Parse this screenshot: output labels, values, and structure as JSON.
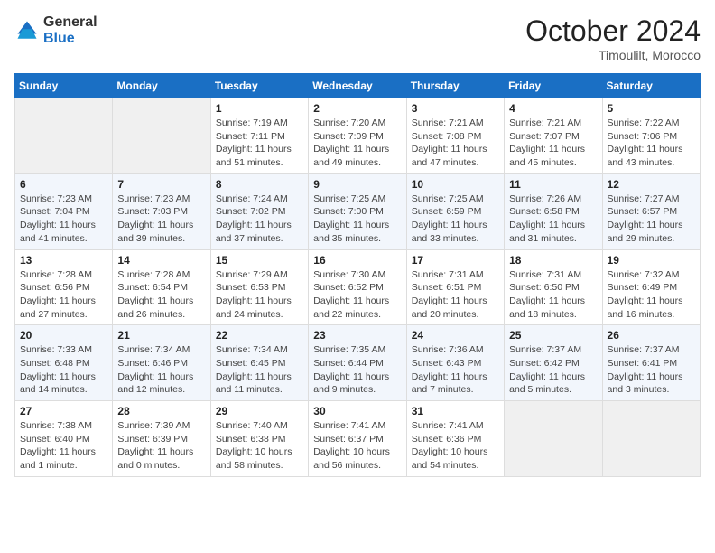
{
  "header": {
    "logo_general": "General",
    "logo_blue": "Blue",
    "month_title": "October 2024",
    "location": "Timoulilt, Morocco"
  },
  "days_of_week": [
    "Sunday",
    "Monday",
    "Tuesday",
    "Wednesday",
    "Thursday",
    "Friday",
    "Saturday"
  ],
  "weeks": [
    [
      {
        "day": "",
        "sunrise": "",
        "sunset": "",
        "daylight": ""
      },
      {
        "day": "",
        "sunrise": "",
        "sunset": "",
        "daylight": ""
      },
      {
        "day": "1",
        "sunrise": "Sunrise: 7:19 AM",
        "sunset": "Sunset: 7:11 PM",
        "daylight": "Daylight: 11 hours and 51 minutes."
      },
      {
        "day": "2",
        "sunrise": "Sunrise: 7:20 AM",
        "sunset": "Sunset: 7:09 PM",
        "daylight": "Daylight: 11 hours and 49 minutes."
      },
      {
        "day": "3",
        "sunrise": "Sunrise: 7:21 AM",
        "sunset": "Sunset: 7:08 PM",
        "daylight": "Daylight: 11 hours and 47 minutes."
      },
      {
        "day": "4",
        "sunrise": "Sunrise: 7:21 AM",
        "sunset": "Sunset: 7:07 PM",
        "daylight": "Daylight: 11 hours and 45 minutes."
      },
      {
        "day": "5",
        "sunrise": "Sunrise: 7:22 AM",
        "sunset": "Sunset: 7:06 PM",
        "daylight": "Daylight: 11 hours and 43 minutes."
      }
    ],
    [
      {
        "day": "6",
        "sunrise": "Sunrise: 7:23 AM",
        "sunset": "Sunset: 7:04 PM",
        "daylight": "Daylight: 11 hours and 41 minutes."
      },
      {
        "day": "7",
        "sunrise": "Sunrise: 7:23 AM",
        "sunset": "Sunset: 7:03 PM",
        "daylight": "Daylight: 11 hours and 39 minutes."
      },
      {
        "day": "8",
        "sunrise": "Sunrise: 7:24 AM",
        "sunset": "Sunset: 7:02 PM",
        "daylight": "Daylight: 11 hours and 37 minutes."
      },
      {
        "day": "9",
        "sunrise": "Sunrise: 7:25 AM",
        "sunset": "Sunset: 7:00 PM",
        "daylight": "Daylight: 11 hours and 35 minutes."
      },
      {
        "day": "10",
        "sunrise": "Sunrise: 7:25 AM",
        "sunset": "Sunset: 6:59 PM",
        "daylight": "Daylight: 11 hours and 33 minutes."
      },
      {
        "day": "11",
        "sunrise": "Sunrise: 7:26 AM",
        "sunset": "Sunset: 6:58 PM",
        "daylight": "Daylight: 11 hours and 31 minutes."
      },
      {
        "day": "12",
        "sunrise": "Sunrise: 7:27 AM",
        "sunset": "Sunset: 6:57 PM",
        "daylight": "Daylight: 11 hours and 29 minutes."
      }
    ],
    [
      {
        "day": "13",
        "sunrise": "Sunrise: 7:28 AM",
        "sunset": "Sunset: 6:56 PM",
        "daylight": "Daylight: 11 hours and 27 minutes."
      },
      {
        "day": "14",
        "sunrise": "Sunrise: 7:28 AM",
        "sunset": "Sunset: 6:54 PM",
        "daylight": "Daylight: 11 hours and 26 minutes."
      },
      {
        "day": "15",
        "sunrise": "Sunrise: 7:29 AM",
        "sunset": "Sunset: 6:53 PM",
        "daylight": "Daylight: 11 hours and 24 minutes."
      },
      {
        "day": "16",
        "sunrise": "Sunrise: 7:30 AM",
        "sunset": "Sunset: 6:52 PM",
        "daylight": "Daylight: 11 hours and 22 minutes."
      },
      {
        "day": "17",
        "sunrise": "Sunrise: 7:31 AM",
        "sunset": "Sunset: 6:51 PM",
        "daylight": "Daylight: 11 hours and 20 minutes."
      },
      {
        "day": "18",
        "sunrise": "Sunrise: 7:31 AM",
        "sunset": "Sunset: 6:50 PM",
        "daylight": "Daylight: 11 hours and 18 minutes."
      },
      {
        "day": "19",
        "sunrise": "Sunrise: 7:32 AM",
        "sunset": "Sunset: 6:49 PM",
        "daylight": "Daylight: 11 hours and 16 minutes."
      }
    ],
    [
      {
        "day": "20",
        "sunrise": "Sunrise: 7:33 AM",
        "sunset": "Sunset: 6:48 PM",
        "daylight": "Daylight: 11 hours and 14 minutes."
      },
      {
        "day": "21",
        "sunrise": "Sunrise: 7:34 AM",
        "sunset": "Sunset: 6:46 PM",
        "daylight": "Daylight: 11 hours and 12 minutes."
      },
      {
        "day": "22",
        "sunrise": "Sunrise: 7:34 AM",
        "sunset": "Sunset: 6:45 PM",
        "daylight": "Daylight: 11 hours and 11 minutes."
      },
      {
        "day": "23",
        "sunrise": "Sunrise: 7:35 AM",
        "sunset": "Sunset: 6:44 PM",
        "daylight": "Daylight: 11 hours and 9 minutes."
      },
      {
        "day": "24",
        "sunrise": "Sunrise: 7:36 AM",
        "sunset": "Sunset: 6:43 PM",
        "daylight": "Daylight: 11 hours and 7 minutes."
      },
      {
        "day": "25",
        "sunrise": "Sunrise: 7:37 AM",
        "sunset": "Sunset: 6:42 PM",
        "daylight": "Daylight: 11 hours and 5 minutes."
      },
      {
        "day": "26",
        "sunrise": "Sunrise: 7:37 AM",
        "sunset": "Sunset: 6:41 PM",
        "daylight": "Daylight: 11 hours and 3 minutes."
      }
    ],
    [
      {
        "day": "27",
        "sunrise": "Sunrise: 7:38 AM",
        "sunset": "Sunset: 6:40 PM",
        "daylight": "Daylight: 11 hours and 1 minute."
      },
      {
        "day": "28",
        "sunrise": "Sunrise: 7:39 AM",
        "sunset": "Sunset: 6:39 PM",
        "daylight": "Daylight: 11 hours and 0 minutes."
      },
      {
        "day": "29",
        "sunrise": "Sunrise: 7:40 AM",
        "sunset": "Sunset: 6:38 PM",
        "daylight": "Daylight: 10 hours and 58 minutes."
      },
      {
        "day": "30",
        "sunrise": "Sunrise: 7:41 AM",
        "sunset": "Sunset: 6:37 PM",
        "daylight": "Daylight: 10 hours and 56 minutes."
      },
      {
        "day": "31",
        "sunrise": "Sunrise: 7:41 AM",
        "sunset": "Sunset: 6:36 PM",
        "daylight": "Daylight: 10 hours and 54 minutes."
      },
      {
        "day": "",
        "sunrise": "",
        "sunset": "",
        "daylight": ""
      },
      {
        "day": "",
        "sunrise": "",
        "sunset": "",
        "daylight": ""
      }
    ]
  ]
}
